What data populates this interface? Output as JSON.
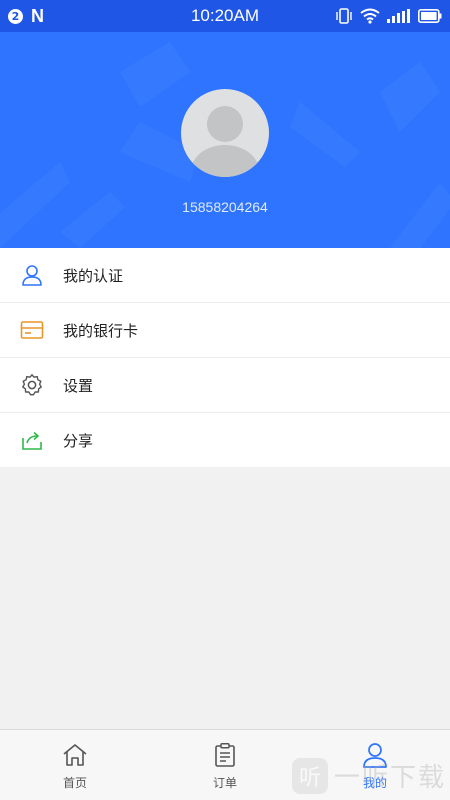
{
  "status_bar": {
    "notification_count": "2",
    "app_badge": "N",
    "time": "10:20AM",
    "icons": [
      "vibrate-icon",
      "wifi-icon",
      "signal-icon",
      "battery-icon"
    ]
  },
  "profile": {
    "phone": "15858204264",
    "avatar_icon": "default-avatar-icon"
  },
  "menu": {
    "items": [
      {
        "label": "我的认证",
        "icon": "user-verify-icon",
        "color": "#2f74ff"
      },
      {
        "label": "我的银行卡",
        "icon": "bank-card-icon",
        "color": "#e8962a"
      },
      {
        "label": "设置",
        "icon": "gear-icon",
        "color": "#555555"
      },
      {
        "label": "分享",
        "icon": "share-icon",
        "color": "#2fba4b"
      }
    ]
  },
  "tabbar": {
    "tabs": [
      {
        "label": "首页",
        "icon": "home-icon"
      },
      {
        "label": "订单",
        "icon": "order-icon"
      },
      {
        "label": "我的",
        "icon": "profile-icon",
        "active": true
      }
    ]
  },
  "watermark": {
    "text": "一听下载",
    "glyph": "听"
  },
  "colors": {
    "status_bar": "#1f56e6",
    "header": "#2f74ff",
    "accent": "#2f74ff",
    "background": "#f1f1f1"
  }
}
